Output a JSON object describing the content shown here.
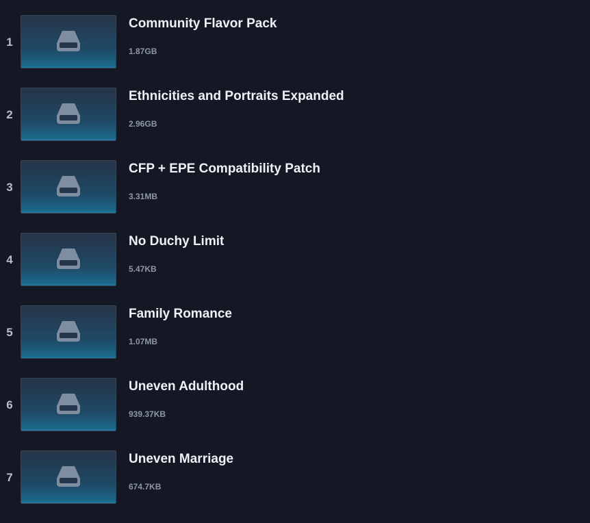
{
  "mods": [
    {
      "index": "1",
      "title": "Community Flavor Pack",
      "size": "1.87GB",
      "icon": "drive-icon"
    },
    {
      "index": "2",
      "title": "Ethnicities and Portraits Expanded",
      "size": "2.96GB",
      "icon": "drive-icon"
    },
    {
      "index": "3",
      "title": "CFP + EPE Compatibility Patch",
      "size": "3.31MB",
      "icon": "drive-icon"
    },
    {
      "index": "4",
      "title": "No Duchy Limit",
      "size": "5.47KB",
      "icon": "drive-icon"
    },
    {
      "index": "5",
      "title": "Family Romance",
      "size": "1.07MB",
      "icon": "drive-icon"
    },
    {
      "index": "6",
      "title": "Uneven Adulthood",
      "size": "939.37KB",
      "icon": "drive-icon"
    },
    {
      "index": "7",
      "title": "Uneven Marriage",
      "size": "674.7KB",
      "icon": "drive-icon"
    }
  ]
}
